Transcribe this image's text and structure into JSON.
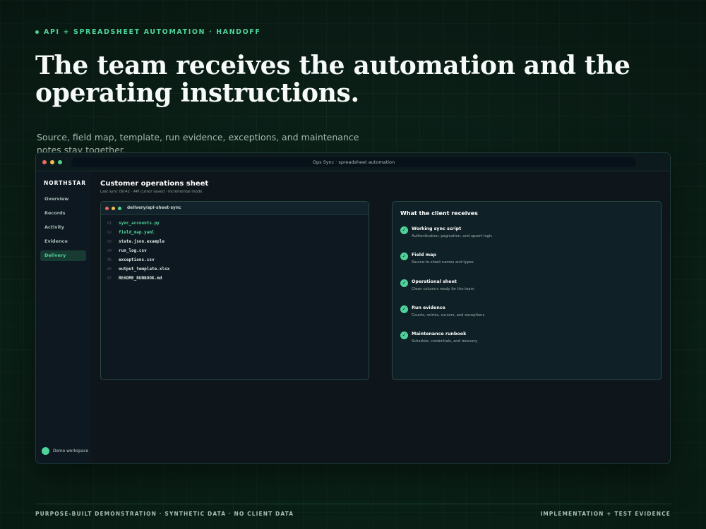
{
  "eyebrow": "API + SPREADSHEET AUTOMATION · HANDOFF",
  "headline": "The team receives the automation and the operating instructions.",
  "subtitle": "Source, field map, template, run evidence, exceptions, and maintenance notes stay together.",
  "window": {
    "address": "Ops Sync · spreadsheet automation",
    "brand": "NORTHSTAR",
    "nav": [
      "Overview",
      "Records",
      "Activity",
      "Evidence",
      "Delivery"
    ],
    "active_nav": "Delivery",
    "workspace": "Demo workspace",
    "title": "Customer operations sheet",
    "meta": "Last sync 09:42 · API cursor saved · incremental mode",
    "files_panel": {
      "title": "delivery/api-sheet-sync",
      "files": [
        {
          "line": "01",
          "name": "sync_accounts.py"
        },
        {
          "line": "02",
          "name": "field_map.yaml"
        },
        {
          "line": "03",
          "name": "state.json.example"
        },
        {
          "line": "04",
          "name": "run_log.csv"
        },
        {
          "line": "05",
          "name": "exceptions.csv"
        },
        {
          "line": "06",
          "name": "output_template.xlsx"
        },
        {
          "line": "07",
          "name": "README_RUNBOOK.md"
        }
      ]
    },
    "receives_panel": {
      "title": "What the client receives",
      "items": [
        {
          "title": "Working sync script",
          "desc": "Authentication, pagination, and upsert logic"
        },
        {
          "title": "Field map",
          "desc": "Source-to-sheet names and types"
        },
        {
          "title": "Operational sheet",
          "desc": "Clean columns ready for the team"
        },
        {
          "title": "Run evidence",
          "desc": "Counts, retries, cursors, and exceptions"
        },
        {
          "title": "Maintenance runbook",
          "desc": "Schedule, credentials, and recovery"
        }
      ]
    }
  },
  "footer": {
    "left": "PURPOSE-BUILT DEMONSTRATION · SYNTHETIC DATA · NO CLIENT DATA",
    "right": "IMPLEMENTATION + TEST EVIDENCE"
  },
  "colors": {
    "accent": "#4fd39a",
    "background": "#0c2219",
    "window": "#0e161c"
  }
}
